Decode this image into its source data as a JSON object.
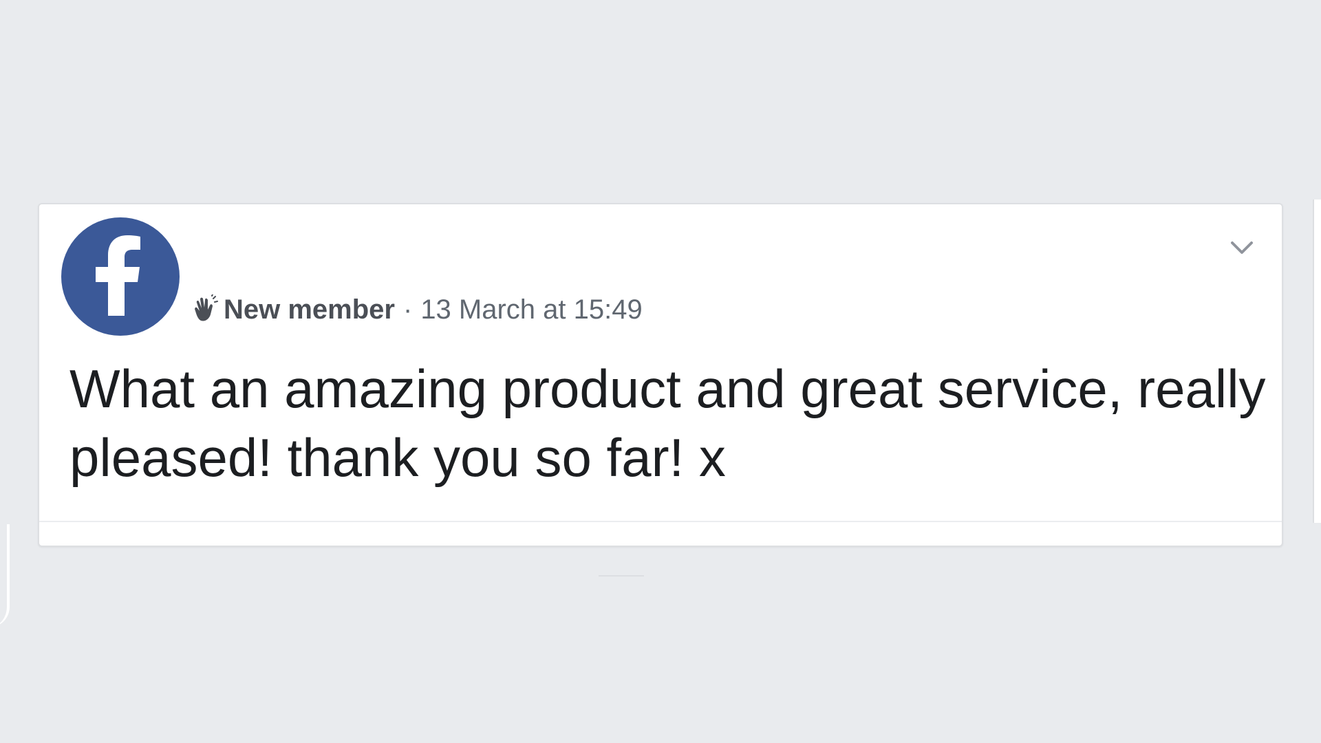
{
  "post": {
    "badge_label": "New member",
    "separator": "·",
    "timestamp": "13 March at 15:49",
    "text": "What an amazing product and great service, really pleased! thank you so far! x"
  },
  "avatar": {
    "logo_letter": "f",
    "brand_color": "#3b5998"
  },
  "icons": {
    "badge": "wave-hand-icon",
    "menu": "chevron-down-icon"
  },
  "colors": {
    "background": "#e9ebee",
    "card": "#ffffff",
    "text_primary": "#1c1e21",
    "text_secondary": "#606770"
  }
}
